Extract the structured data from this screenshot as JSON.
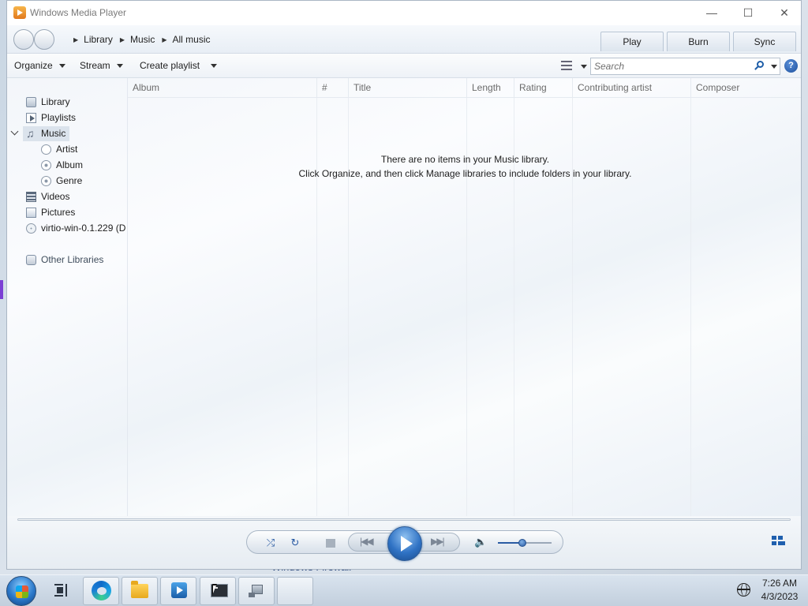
{
  "window": {
    "title": "Windows Media Player",
    "minimize_glyph": "—",
    "maximize_glyph": "☐",
    "close_glyph": "✕"
  },
  "breadcrumb": [
    "Library",
    "Music",
    "All music"
  ],
  "top_tabs": [
    "Play",
    "Burn",
    "Sync"
  ],
  "toolbar": {
    "organize": "Organize",
    "stream": "Stream",
    "create_playlist": "Create playlist",
    "search_placeholder": "Search",
    "help_glyph": "?"
  },
  "nav": {
    "library": "Library",
    "playlists": "Playlists",
    "music": "Music",
    "artist": "Artist",
    "album": "Album",
    "genre": "Genre",
    "videos": "Videos",
    "pictures": "Pictures",
    "drive": "virtio-win-0.1.229 (D",
    "other_libraries": "Other Libraries"
  },
  "columns": [
    "Album",
    "#",
    "Title",
    "Length",
    "Rating",
    "Contributing artist",
    "Composer"
  ],
  "empty_message": {
    "line1": "There are no items in your Music library.",
    "line2": "Click Organize, and then click Manage libraries to include folders in your library."
  },
  "player": {
    "shuffle_glyph": "⤮",
    "repeat_glyph": "↻",
    "prev_glyph": "|◀◀",
    "next_glyph": "▶▶|",
    "volume_glyph": "🔈",
    "volume_level": 0.45
  },
  "background_window_text": "Windows Firewall",
  "taskbar": {
    "time": "7:26 AM",
    "date": "4/3/2023"
  },
  "colors": {
    "accent": "#2a5ba3",
    "selection": "#dbe3ec",
    "left_strip": "#7b3fd4"
  }
}
